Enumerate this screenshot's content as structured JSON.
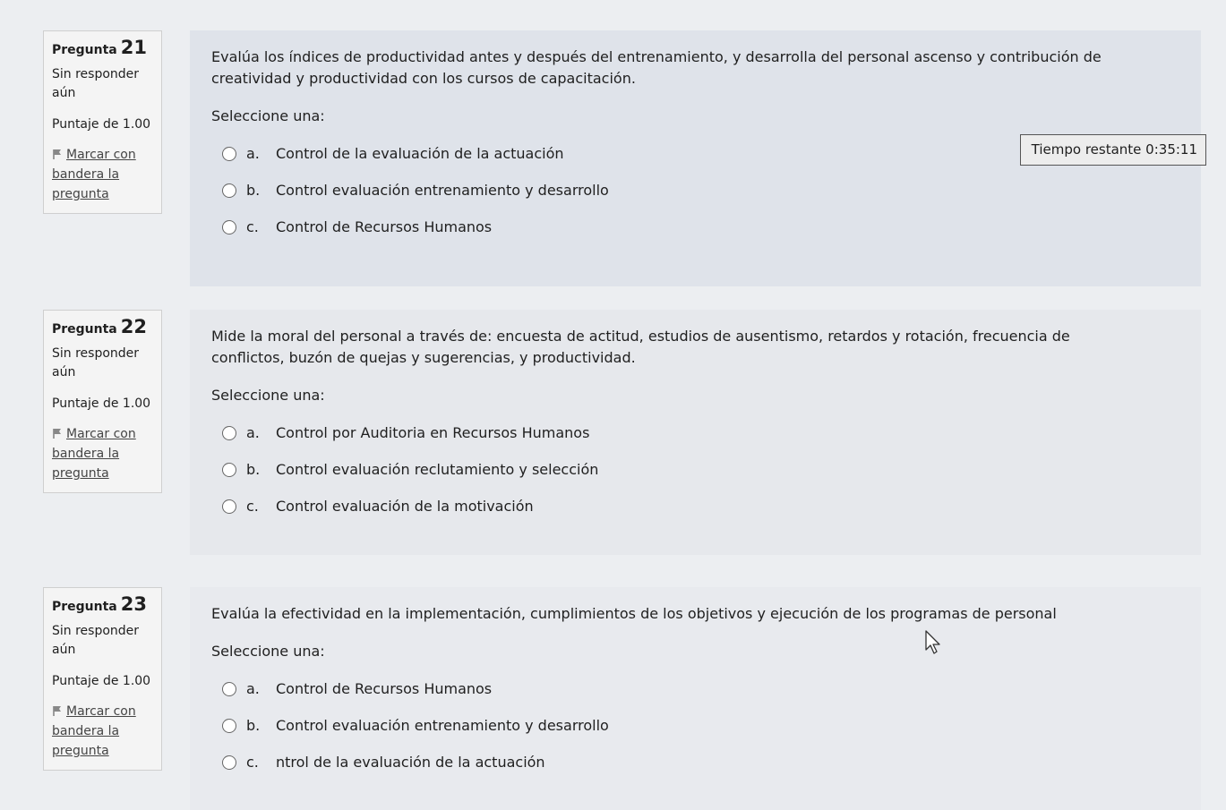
{
  "timer": {
    "label": "Tiempo restante",
    "value": "0:35:11"
  },
  "questions": [
    {
      "label": "Pregunta",
      "number": "21",
      "state": "Sin responder aún",
      "grade": "Puntaje de 1.00",
      "flag": "Marcar con bandera la pregunta",
      "text": "Evalúa los índices de productividad antes y después del entrenamiento, y desarrolla del personal ascenso y contribución de creatividad y productividad con los cursos de capacitación.",
      "prompt": "Seleccione una:",
      "answers": [
        {
          "letter": "a.",
          "text": "Control de la evaluación de la actuación"
        },
        {
          "letter": "b.",
          "text": "Control evaluación entrenamiento y desarrollo"
        },
        {
          "letter": "c.",
          "text": "Control de Recursos Humanos"
        }
      ]
    },
    {
      "label": "Pregunta",
      "number": "22",
      "state": "Sin responder aún",
      "grade": "Puntaje de 1.00",
      "flag": "Marcar con bandera la pregunta",
      "text": "Mide la moral del personal a través de: encuesta de actitud, estudios de ausentismo, retardos y rotación, frecuencia de conflictos, buzón de quejas y sugerencias, y productividad.",
      "prompt": "Seleccione una:",
      "answers": [
        {
          "letter": "a.",
          "text": "Control por Auditoria en Recursos Humanos"
        },
        {
          "letter": "b.",
          "text": "Control evaluación reclutamiento y selección"
        },
        {
          "letter": "c.",
          "text": "Control evaluación de la motivación"
        }
      ]
    },
    {
      "label": "Pregunta",
      "number": "23",
      "state": "Sin responder aún",
      "grade": "Puntaje de 1.00",
      "flag": "Marcar con bandera la pregunta",
      "text": "Evalúa la efectividad en la implementación, cumplimientos de los objetivos y ejecución de los programas de personal",
      "prompt": "Seleccione una:",
      "answers": [
        {
          "letter": "a.",
          "text": "Control de Recursos Humanos"
        },
        {
          "letter": "b.",
          "text": "Control evaluación entrenamiento y desarrollo"
        },
        {
          "letter": "c.",
          "text": "ntrol de la evaluación de la actuación"
        }
      ]
    }
  ]
}
